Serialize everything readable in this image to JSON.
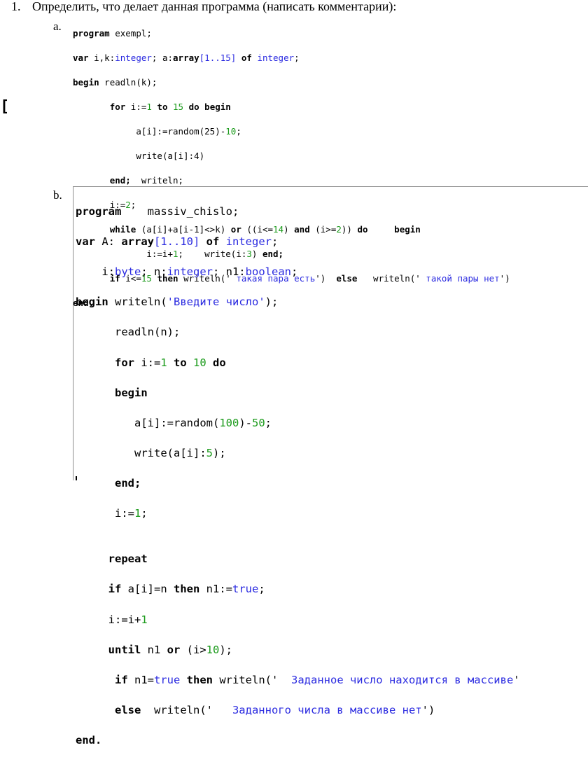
{
  "heading": {
    "number": "1.",
    "text": "Определить, что делает данная программа (написать комментарии):"
  },
  "labels": {
    "a": "a.",
    "b": "b."
  },
  "margin_mark": "[",
  "program_a": {
    "line1_kw": "program",
    "line1_name": " exempl;",
    "line2_kw": "var",
    "line2_vars": " i,k:",
    "line2_type1": "integer",
    "line2_mid": "; a:",
    "line2_kw2": "array",
    "line2_range": "[1..15]",
    "line2_of": " of ",
    "line2_type2": "integer",
    "line2_end": ";",
    "line3_kw": "begin",
    "line3_rest": " readln(k);",
    "line4_for": "for",
    "line4_mid": " i:=",
    "line4_n1": "1",
    "line4_to": " to ",
    "line4_n2": "15",
    "line4_do": " do begin",
    "line5_a": "a[i]:=random(25)-",
    "line5_n": "10",
    "line5_end": ";",
    "line6": "write(a[i]:4)",
    "line7_end": "end;",
    "line7_rest": "  writeln;",
    "line8_a": "i:=",
    "line8_n": "2",
    "line8_end": ";",
    "line9_while": "while",
    "line9_a": " (a[i]+a[i-1]<>k) ",
    "line9_or": "or",
    "line9_b": " ((i<=",
    "line9_n1": "14",
    "line9_c": ") ",
    "line9_and": "and",
    "line9_d": " (i>=",
    "line9_n2": "2",
    "line9_e": ")) ",
    "line9_do": "do",
    "line9_sp": "     ",
    "line9_begin": "begin",
    "line10_a": "i:=i+",
    "line10_n": "1",
    "line10_b": ";    write(i:",
    "line10_n2": "3",
    "line10_c": ") ",
    "line10_end": "end;",
    "line11_if": "if",
    "line11_a": " i<=",
    "line11_n": "15",
    "line11_then": " then",
    "line11_b": " writeln('",
    "line11_s1": " такая пара есть",
    "line11_c": "')  ",
    "line11_else": "else",
    "line11_d": "   writeln('",
    "line11_s2": " такой пары нет",
    "line11_e": "')",
    "line12": "end."
  },
  "program_b": {
    "l1_kw": "program",
    "l1_name": "    massiv_chislo;",
    "l2_kw": "var",
    "l2_a": " A: ",
    "l2_kw2": "array",
    "l2_range": "[1..10]",
    "l2_of": " of ",
    "l2_type": "integer",
    "l2_end": ";",
    "l3_a": "    i:",
    "l3_t1": "byte",
    "l3_b": "; n:",
    "l3_t2": "integer",
    "l3_c": "; n1:",
    "l3_t3": "boolean",
    "l3_end": ";",
    "l4_kw": "begin",
    "l4_a": " writeln(",
    "l4_s": "'Введите число'",
    "l4_end": ");",
    "l5": "readln(n);",
    "l6_for": "for",
    "l6_a": " i:=",
    "l6_n1": "1",
    "l6_to": " to ",
    "l6_n2": "10",
    "l6_do": " do",
    "l7": "begin",
    "l8_a": "a[i]:=random(",
    "l8_n1": "100",
    "l8_b": ")-",
    "l8_n2": "50",
    "l8_end": ";",
    "l9_a": "write(a[i]:",
    "l9_n": "5",
    "l9_end": ");",
    "l10": "end;",
    "l11_a": "i:=",
    "l11_n": "1",
    "l11_end": ";",
    "l12": "",
    "l13": "repeat",
    "l14_if": "if",
    "l14_a": " a[i]=n ",
    "l14_then": "then",
    "l14_b": " n1:=",
    "l14_v": "true",
    "l14_end": ";",
    "l15_a": "i:=i+",
    "l15_n": "1",
    "l16_until": "until",
    "l16_a": " n1 ",
    "l16_or": "or",
    "l16_b": " (i>",
    "l16_n": "10",
    "l16_end": ");",
    "l17_if": "if",
    "l17_a": " n1=",
    "l17_v": "true",
    "l17_then": " then",
    "l17_b": " writeln('",
    "l17_s": "  Заданное число находится в массиве",
    "l17_end": "'",
    "l18_else": "else",
    "l18_a": "  writeln('",
    "l18_s": "   Заданного числа в массиве нет",
    "l18_end": "')",
    "l19": "end."
  }
}
